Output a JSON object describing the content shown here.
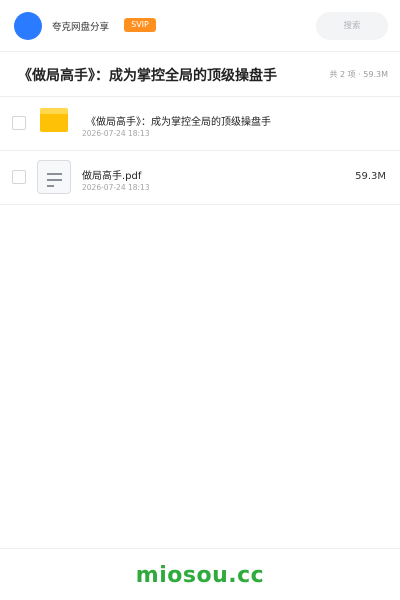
{
  "header": {
    "brand": "夸克网盘分享",
    "badge": "SVIP",
    "search_placeholder": "搜索",
    "avatar_color": "#2a7bff",
    "badge_color": "#ff8f1f"
  },
  "title_bar": {
    "title": "《做局高手》：成为掌控全局的顶级操盘手",
    "summary": "共 2 项 · 59.3M"
  },
  "files": [
    {
      "name": "《做局高手》：成为掌控全局的顶级操盘手",
      "date": "2026-07-24 18:13",
      "size": "",
      "icon": "folder-icon"
    },
    {
      "name": "做局高手.pdf",
      "date": "2026-07-24 18:13",
      "size": "59.3M",
      "icon": "document-icon"
    }
  ],
  "footer": {
    "watermark": "miosou.cc",
    "watermark_color": "#2faa3c"
  }
}
